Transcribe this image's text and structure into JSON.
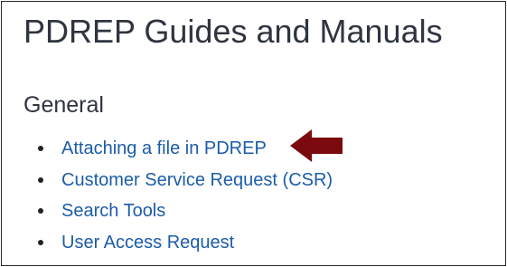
{
  "page": {
    "title": "PDREP Guides and Manuals"
  },
  "section": {
    "heading": "General",
    "items": [
      {
        "label": "Attaching a file in PDREP"
      },
      {
        "label": "Customer Service Request (CSR)"
      },
      {
        "label": "Search Tools"
      },
      {
        "label": "User Access Request"
      }
    ]
  },
  "annotation": {
    "icon": "left-arrow-icon",
    "color": "#7b0a0f"
  }
}
